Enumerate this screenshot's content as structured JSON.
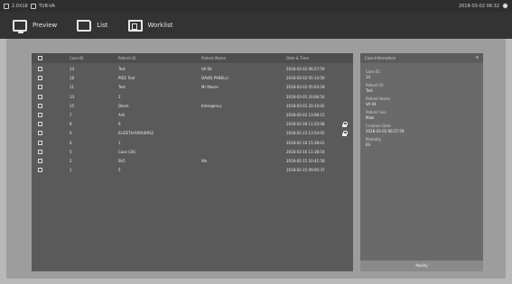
{
  "statusbar": {
    "left_1": "2.0X18",
    "left_2": "TUB-VA",
    "datetime": "2018-03-02 06:32"
  },
  "toolbar": {
    "preview_label": "Preview",
    "list_label": "List",
    "worklist_label": "Worklist"
  },
  "table": {
    "headers": [
      "Case ID",
      "Patient ID",
      "Patient Name",
      "Date & Time"
    ],
    "rows": [
      {
        "case_id": "14",
        "patient_id": "Test",
        "patient_name": "VA 04",
        "datetime": "2018-03-02 06:27:59",
        "locked": false
      },
      {
        "case_id": "18",
        "patient_id": "PID1 Test",
        "patient_name": "DAVID PANELLI",
        "datetime": "2018-03-02 05:14:56",
        "locked": false
      },
      {
        "case_id": "11",
        "patient_id": "Test",
        "patient_name": "Mr Moore",
        "datetime": "2018-03-02 05:03:28",
        "locked": false
      },
      {
        "case_id": "13",
        "patient_id": "2",
        "patient_name": "",
        "datetime": "2018-03-01 20:06:54",
        "locked": false
      },
      {
        "case_id": "15",
        "patient_id": "Desm",
        "patient_name": "Emergency",
        "datetime": "2018-03-01 20:14:02",
        "locked": false
      },
      {
        "case_id": "7",
        "patient_id": "Ash",
        "patient_name": "",
        "datetime": "2018-03-01 13:08:15",
        "locked": false
      },
      {
        "case_id": "8",
        "patient_id": "9",
        "patient_name": "",
        "datetime": "2018-02-28 11:25:08",
        "locked": true
      },
      {
        "case_id": "6",
        "patient_id": "ELIZETH-R09U0RS2",
        "patient_name": "",
        "datetime": "2018-02-23 13:54:02",
        "locked": true
      },
      {
        "case_id": "4",
        "patient_id": "1",
        "patient_name": "",
        "datetime": "2018-02-16 15:28:01",
        "locked": false
      },
      {
        "case_id": "5",
        "patient_id": "Case (34)",
        "patient_name": "",
        "datetime": "2018-02-16 11:38:54",
        "locked": false
      },
      {
        "case_id": "2",
        "patient_id": "Sh5",
        "patient_name": "We",
        "datetime": "2018-02-15 20:41:58",
        "locked": false
      },
      {
        "case_id": "1",
        "patient_id": "5",
        "patient_name": "",
        "datetime": "2018-02-15 09:05:37",
        "locked": false
      }
    ]
  },
  "case_info": {
    "title": "Case Information",
    "close_glyph": "x",
    "fields": [
      {
        "label": "Case ID",
        "value": "14"
      },
      {
        "label": "Patient ID",
        "value": "Test"
      },
      {
        "label": "Patient Name",
        "value": "VA 04"
      },
      {
        "label": "Patient Sex",
        "value": "Male"
      },
      {
        "label": "Creation Date",
        "value": "2018-03-02 06:27:59"
      },
      {
        "label": "Modality",
        "value": "ES"
      }
    ],
    "button_label": "Modify"
  }
}
